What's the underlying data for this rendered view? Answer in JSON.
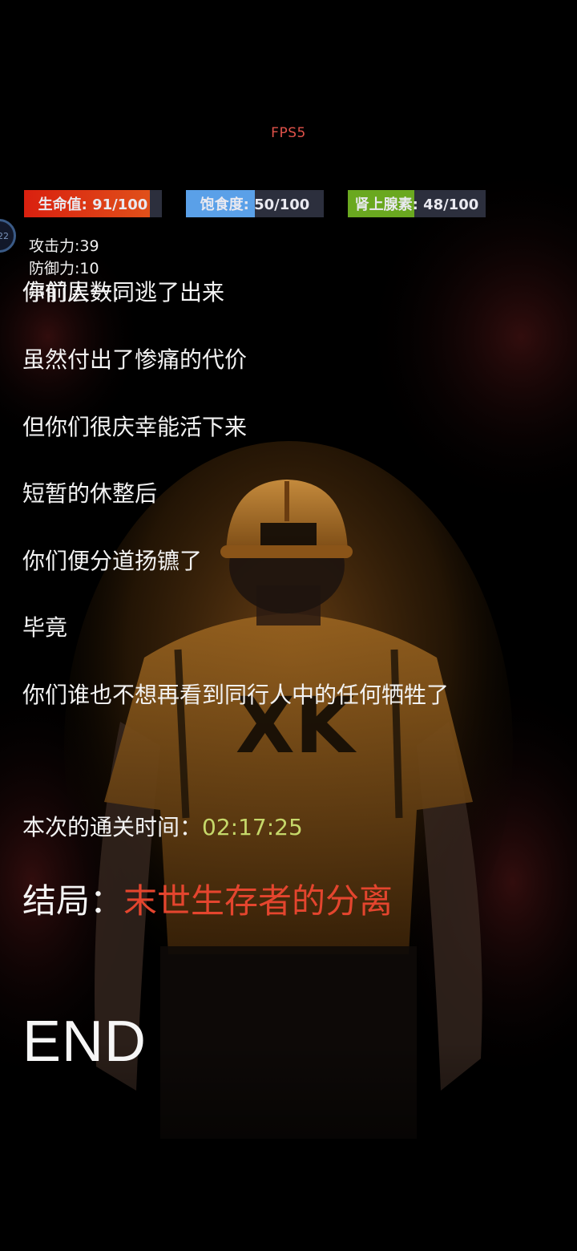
{
  "hud": {
    "fps_label": "FPS5",
    "side_badge": "22",
    "bars": [
      {
        "label": "生命值: 91/100",
        "value": 91,
        "max": 100,
        "color": "#d9200f",
        "color2": "#e0501a"
      },
      {
        "label": "饱食度: 50/100",
        "value": 50,
        "max": 100,
        "color": "#5aa0e8",
        "color2": "#5aa0e8"
      },
      {
        "label": "肾上腺素: 48/100",
        "value": 48,
        "max": 100,
        "color": "#6aa820",
        "color2": "#6aa820"
      }
    ],
    "attack": "攻击力:39",
    "defense": "防御力:10",
    "overlap_a": "停前层数:",
    "overlap_b": "你们人一同逃了出来"
  },
  "story": {
    "lines": [
      "虽然付出了惨痛的代价",
      "但你们很庆幸能活下来",
      "短暂的休整后",
      "你们便分道扬镳了",
      "毕竟",
      "你们谁也不想再看到同行人中的任何牺牲了"
    ],
    "time_label": "本次的通关时间：",
    "time_value": "02:17:25",
    "ending_label": "结局：",
    "ending_value": "末世生存者的分离",
    "end_text": "END"
  },
  "colors": {
    "background": "#000000",
    "fps": "#e0524a",
    "time": "#c6d86a",
    "ending": "#e4452e",
    "helmet": "#b8762a",
    "vest": "#8a5418"
  },
  "background_art": {
    "figure": "worker-in-orange-vest-back-view",
    "vest_logo": "XK"
  }
}
